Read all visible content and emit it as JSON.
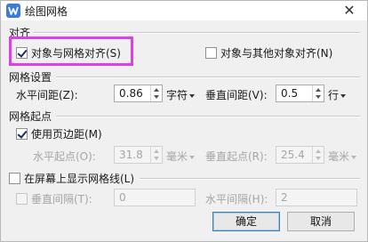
{
  "window": {
    "title": "绘图网格",
    "close_glyph": "✕"
  },
  "alignment": {
    "group_label": "对齐",
    "snap_to_grid": {
      "label": "对象与网格对齐(S)",
      "checked": true
    },
    "snap_to_objects": {
      "label": "对象与其他对象对齐(N)",
      "checked": false
    }
  },
  "grid_settings": {
    "group_label": "网格设置",
    "horizontal_spacing": {
      "label": "水平间距(Z):",
      "value": "0.86",
      "unit": "字符"
    },
    "vertical_spacing": {
      "label": "垂直间距(V):",
      "value": "0.5",
      "unit": "行"
    }
  },
  "grid_origin": {
    "group_label": "网格起点",
    "use_margins": {
      "label": "使用页边距(M)",
      "checked": true
    },
    "horizontal_origin": {
      "label": "水平起点(O):",
      "value": "31.8",
      "unit": "毫米"
    },
    "vertical_origin": {
      "label": "垂直起点(R):",
      "value": "25.4",
      "unit": "毫米"
    }
  },
  "display": {
    "show_gridlines": {
      "label": "在屏幕上显示网格线(L)",
      "checked": false
    },
    "vertical_interval": {
      "label": "垂直间隔(T):",
      "value": "0",
      "checked": false
    },
    "horizontal_interval": {
      "label": "水平间隔(H):",
      "value": "2"
    }
  },
  "buttons": {
    "ok": "确定",
    "cancel": "取消"
  },
  "colors": {
    "highlight": "#e23ee6",
    "app_icon": "#3a7be0"
  }
}
